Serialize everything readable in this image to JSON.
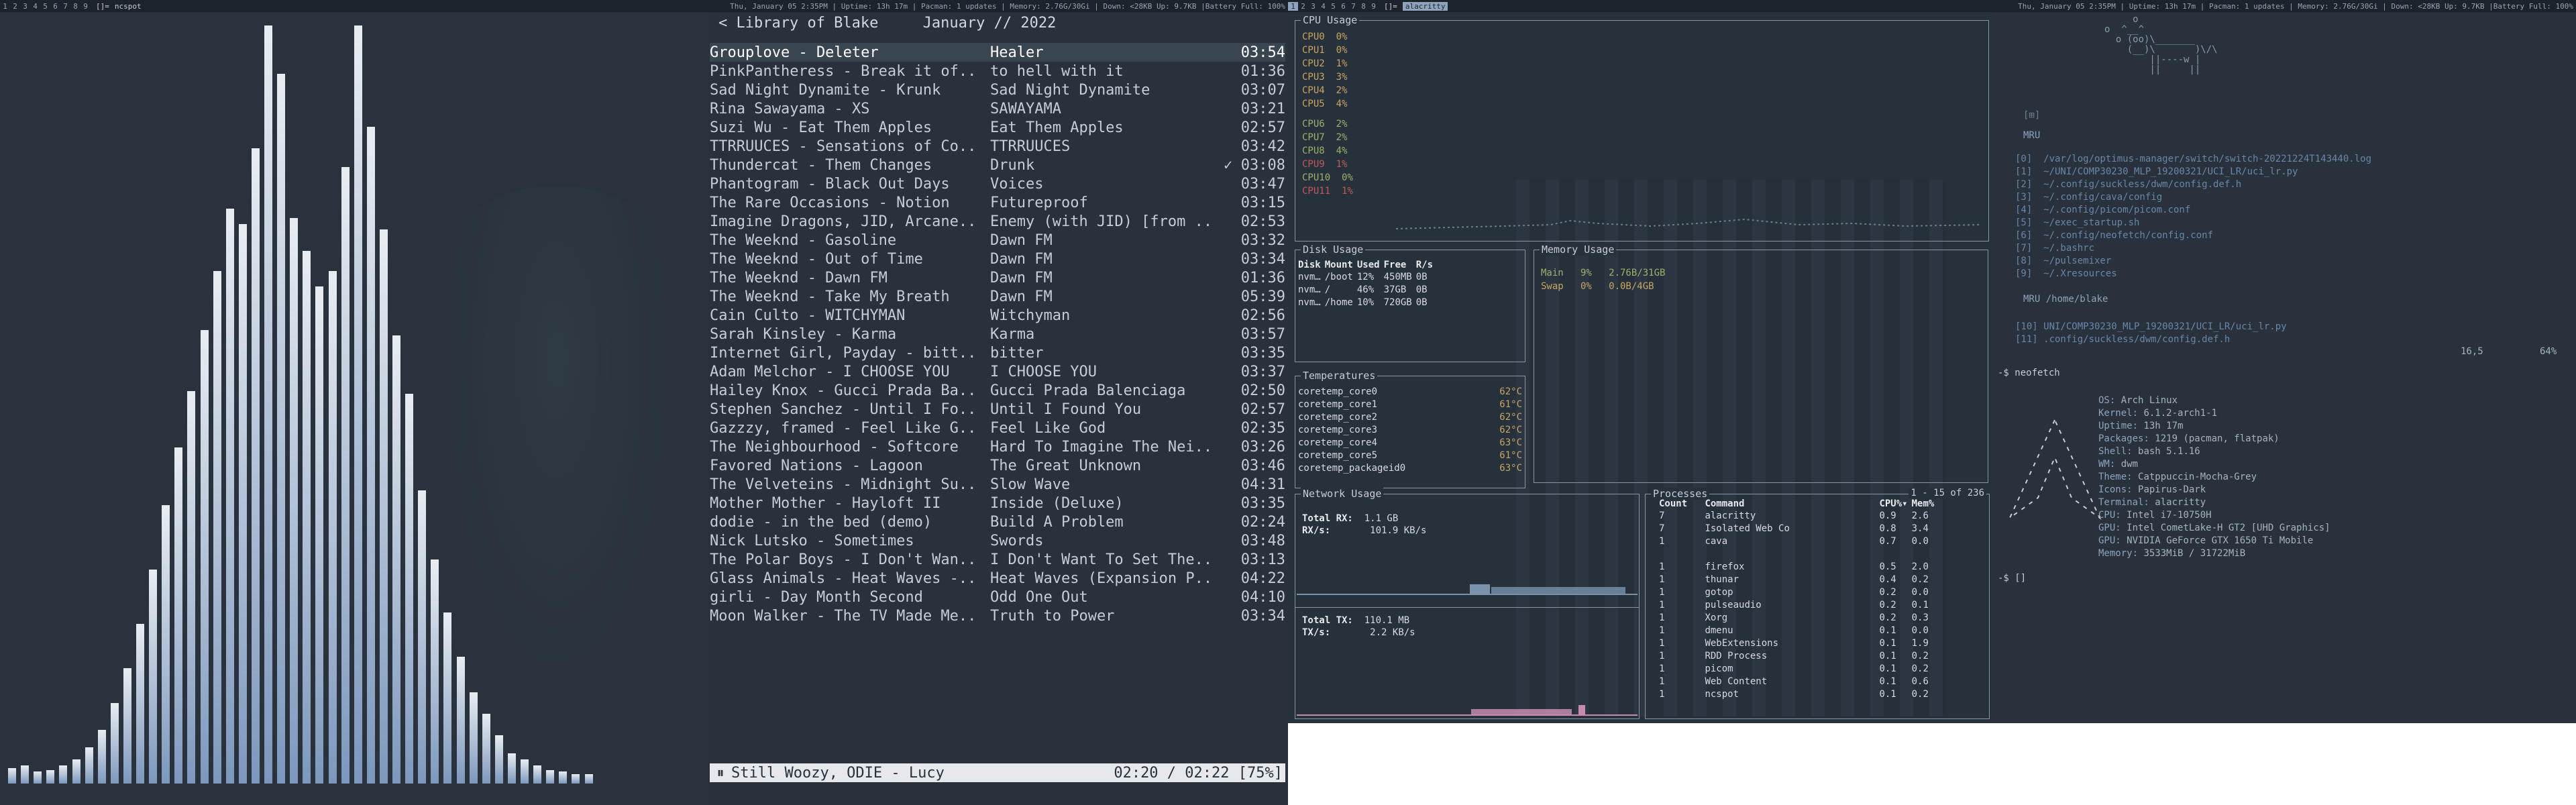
{
  "bar_left": {
    "workspaces": [
      "1",
      "2",
      "3",
      "4",
      "5",
      "6",
      "7",
      "8",
      "9"
    ],
    "layout": "[]=",
    "title": "ncspot",
    "status": "Thu, January 05 2:35PM | Uptime: 13h 17m | Pacman: 1 updates | Memory: 2.76G/30Gi | Down: <28KB Up: 9.7KB |Battery Full: 100%"
  },
  "bar_right": {
    "workspaces": [
      "1",
      "2",
      "3",
      "4",
      "5",
      "6",
      "7",
      "8",
      "9"
    ],
    "layout": "[]=",
    "title": "alacritty",
    "status": "Thu, January 05 2:35PM | Uptime: 13h 17m | Pacman: 1 updates | Memory: 2.76G/30Gi | Down: <28KB Up: 9.7KB |Battery Full: 100%"
  },
  "visualizer": {
    "bar_levels": [
      0.02,
      0.024,
      0.016,
      0.018,
      0.024,
      0.032,
      0.048,
      0.071,
      0.106,
      0.152,
      0.211,
      0.282,
      0.367,
      0.443,
      0.518,
      0.598,
      0.676,
      0.758,
      0.738,
      0.838,
      1.0,
      0.936,
      0.746,
      0.703,
      0.656,
      0.676,
      0.813,
      1.0,
      0.866,
      0.731,
      0.591,
      0.514,
      0.387,
      0.296,
      0.226,
      0.167,
      0.12,
      0.092,
      0.064,
      0.04,
      0.032,
      0.024,
      0.018,
      0.016,
      0.012,
      0.012
    ]
  },
  "music": {
    "header": "< Library of Blake     January // 2022",
    "tracks": [
      {
        "artist_title": "Grouplove - Deleter",
        "album": "Healer",
        "length": "03:54",
        "selected": true,
        "playing": false
      },
      {
        "artist_title": "PinkPantheress - Break it of..",
        "album": "to hell with it",
        "length": "01:36",
        "selected": false,
        "playing": false
      },
      {
        "artist_title": "Sad Night Dynamite - Krunk",
        "album": "Sad Night Dynamite",
        "length": "03:07",
        "selected": false,
        "playing": false
      },
      {
        "artist_title": "Rina Sawayama - XS",
        "album": "SAWAYAMA",
        "length": "03:21",
        "selected": false,
        "playing": false
      },
      {
        "artist_title": "Suzi Wu - Eat Them Apples",
        "album": "Eat Them Apples",
        "length": "02:57",
        "selected": false,
        "playing": false
      },
      {
        "artist_title": "TTRRUUCES - Sensations of Co..",
        "album": "TTRRUUCES",
        "length": "03:42",
        "selected": false,
        "playing": false
      },
      {
        "artist_title": "Thundercat - Them Changes",
        "album": "Drunk",
        "length": "03:08",
        "selected": false,
        "playing": true
      },
      {
        "artist_title": "Phantogram - Black Out Days",
        "album": "Voices",
        "length": "03:47",
        "selected": false,
        "playing": false
      },
      {
        "artist_title": "The Rare Occasions - Notion",
        "album": "Futureproof",
        "length": "03:15",
        "selected": false,
        "playing": false
      },
      {
        "artist_title": "Imagine Dragons, JID, Arcane..",
        "album": "Enemy (with JID) [from ..",
        "length": "02:53",
        "selected": false,
        "playing": false
      },
      {
        "artist_title": "The Weeknd - Gasoline",
        "album": "Dawn FM",
        "length": "03:32",
        "selected": false,
        "playing": false
      },
      {
        "artist_title": "The Weeknd - Out of Time",
        "album": "Dawn FM",
        "length": "03:34",
        "selected": false,
        "playing": false
      },
      {
        "artist_title": "The Weeknd - Dawn FM",
        "album": "Dawn FM",
        "length": "01:36",
        "selected": false,
        "playing": false
      },
      {
        "artist_title": "The Weeknd - Take My Breath",
        "album": "Dawn FM",
        "length": "05:39",
        "selected": false,
        "playing": false
      },
      {
        "artist_title": "Cain Culto - WITCHYMAN",
        "album": "Witchyman",
        "length": "02:56",
        "selected": false,
        "playing": false
      },
      {
        "artist_title": "Sarah Kinsley - Karma",
        "album": "Karma",
        "length": "03:57",
        "selected": false,
        "playing": false
      },
      {
        "artist_title": "Internet Girl, Payday - bitt..",
        "album": "bitter",
        "length": "03:35",
        "selected": false,
        "playing": false
      },
      {
        "artist_title": "Adam Melchor - I CHOOSE YOU",
        "album": "I CHOOSE YOU",
        "length": "03:37",
        "selected": false,
        "playing": false
      },
      {
        "artist_title": "Hailey Knox - Gucci Prada Ba..",
        "album": "Gucci Prada Balenciaga",
        "length": "02:50",
        "selected": false,
        "playing": false
      },
      {
        "artist_title": "Stephen Sanchez - Until I Fo..",
        "album": "Until I Found You",
        "length": "02:57",
        "selected": false,
        "playing": false
      },
      {
        "artist_title": "Gazzzy, framed - Feel Like G..",
        "album": "Feel Like God",
        "length": "02:35",
        "selected": false,
        "playing": false
      },
      {
        "artist_title": "The Neighbourhood - Softcore",
        "album": "Hard To Imagine The Nei..",
        "length": "03:26",
        "selected": false,
        "playing": false
      },
      {
        "artist_title": "Favored Nations - Lagoon",
        "album": "The Great Unknown",
        "length": "03:46",
        "selected": false,
        "playing": false
      },
      {
        "artist_title": "The Velveteins - Midnight Su..",
        "album": "Slow Wave",
        "length": "04:31",
        "selected": false,
        "playing": false
      },
      {
        "artist_title": "Mother Mother - Hayloft II",
        "album": "Inside (Deluxe)",
        "length": "03:35",
        "selected": false,
        "playing": false
      },
      {
        "artist_title": "dodie - in the bed (demo)",
        "album": "Build A Problem",
        "length": "02:24",
        "selected": false,
        "playing": false
      },
      {
        "artist_title": "Nick Lutsko - Sometimes",
        "album": "Swords",
        "length": "03:48",
        "selected": false,
        "playing": false
      },
      {
        "artist_title": "The Polar Boys - I Don't Wan..",
        "album": "I Don't Want To Set The..",
        "length": "03:13",
        "selected": false,
        "playing": false
      },
      {
        "artist_title": "Glass Animals - Heat Waves -..",
        "album": "Heat Waves (Expansion P..",
        "length": "04:22",
        "selected": false,
        "playing": false
      },
      {
        "artist_title": "girli - Day Month Second",
        "album": "Odd One Out",
        "length": "04:10",
        "selected": false,
        "playing": false
      },
      {
        "artist_title": "Moon Walker - The TV Made Me..",
        "album": "Truth to Power",
        "length": "03:34",
        "selected": false,
        "playing": false
      }
    ],
    "player": {
      "state_icon": "⏸",
      "now_playing": "Still Woozy, ODIE - Lucy",
      "time": "02:20 / 02:22 [75%]"
    }
  },
  "dashboard": {
    "cpu_title": "CPU Usage",
    "cpus": [
      {
        "name": "CPU0",
        "pct": "0%",
        "color": "#c8a560"
      },
      {
        "name": "CPU1",
        "pct": "0%",
        "color": "#c8a560"
      },
      {
        "name": "CPU2",
        "pct": "1%",
        "color": "#c8a560"
      },
      {
        "name": "CPU3",
        "pct": "3%",
        "color": "#c8a560"
      },
      {
        "name": "CPU4",
        "pct": "2%",
        "color": "#c8a560"
      },
      {
        "name": "CPU5",
        "pct": "4%",
        "color": "#c8a560"
      },
      {
        "name": "CPU6",
        "pct": "2%",
        "color": "#9ab26a"
      },
      {
        "name": "CPU7",
        "pct": "2%",
        "color": "#9ab26a"
      },
      {
        "name": "CPU8",
        "pct": "4%",
        "color": "#9ab26a"
      },
      {
        "name": "CPU9",
        "pct": "1%",
        "color": "#c05a5a"
      },
      {
        "name": "CPU10",
        "pct": "0%",
        "color": "#9ab26a"
      },
      {
        "name": "CPU11",
        "pct": "1%",
        "color": "#c05a5a"
      }
    ],
    "disk": {
      "title": "Disk Usage",
      "headers": [
        "Disk",
        "Mount",
        "Used",
        "Free",
        "R/s"
      ],
      "rows": [
        [
          "nvm…",
          "/boot",
          "12%",
          "450MB",
          "0B"
        ],
        [
          "nvm…",
          "/",
          "46%",
          "37GB",
          "0B"
        ],
        [
          "nvm…",
          "/home",
          "10%",
          "720GB",
          "0B"
        ]
      ]
    },
    "memory": {
      "title": "Memory Usage",
      "rows": [
        [
          "Main",
          "9%",
          "2.76B/31GB"
        ],
        [
          "Swap",
          "0%",
          "0.0B/4GB"
        ]
      ]
    },
    "temps": {
      "title": "Temperatures",
      "rows": [
        [
          "coretemp_core0",
          "62°C"
        ],
        [
          "coretemp_core1",
          "61°C"
        ],
        [
          "coretemp_core2",
          "62°C"
        ],
        [
          "coretemp_core3",
          "62°C"
        ],
        [
          "coretemp_core4",
          "63°C"
        ],
        [
          "coretemp_core5",
          "61°C"
        ],
        [
          "coretemp_packageid0",
          "63°C"
        ]
      ]
    },
    "network": {
      "title": "Network Usage",
      "rx_total_label": "Total RX:",
      "rx_total": "1.1 GB",
      "rx_rate_label": "RX/s:",
      "rx_rate": "101.9 KB/s",
      "tx_total_label": "Total TX:",
      "tx_total": "110.1 MB",
      "tx_rate_label": "TX/s:",
      "tx_rate": "2.2 KB/s"
    },
    "processes": {
      "title": "Processes",
      "count": "1 - 15 of 236",
      "headers": [
        "Count",
        "Command",
        "CPU%▾",
        "Mem%"
      ],
      "rows": [
        [
          "7",
          "alacritty",
          "0.9",
          "2.6"
        ],
        [
          "7",
          "Isolated Web Co",
          "0.8",
          "3.4"
        ],
        [
          "1",
          "cava",
          "0.7",
          "0.0"
        ],
        [
          "",
          "",
          "",
          ""
        ],
        [
          "1",
          "firefox",
          "0.5",
          "2.0"
        ],
        [
          "1",
          "thunar",
          "0.4",
          "0.2"
        ],
        [
          "1",
          "gotop",
          "0.2",
          "0.0"
        ],
        [
          "1",
          "pulseaudio",
          "0.2",
          "0.1"
        ],
        [
          "1",
          "Xorg",
          "0.2",
          "0.3"
        ],
        [
          "1",
          "dmenu",
          "0.1",
          "0.0"
        ],
        [
          "1",
          "WebExtensions",
          "0.1",
          "1.9"
        ],
        [
          "1",
          "RDD Process",
          "0.1",
          "0.2"
        ],
        [
          "1",
          "picom",
          "0.1",
          "0.2"
        ],
        [
          "1",
          "Web Content",
          "0.1",
          "0.6"
        ],
        [
          "1",
          "ncspot",
          "0.1",
          "0.2"
        ]
      ]
    }
  },
  "terminal": {
    "ascii_art": [
      "            o",
      "       o  ^__^",
      "         o (oo)\\_______",
      "           (__)\\       )\\/\\",
      "               ||----w |",
      "               ||     ||"
    ],
    "mru_label": "MRU",
    "mru": [
      "[0]  /var/log/optimus-manager/switch/switch-20221224T143440.log",
      "[1]  ~/UNI/COMP30230_MLP_19200321/UCI_LR/uci_lr.py",
      "[2]  ~/.config/suckless/dwm/config.def.h",
      "[3]  ~/.config/cava/config",
      "[4]  ~/.config/picom/picom.conf",
      "[5]  ~/exec_startup.sh",
      "[6]  ~/.config/neofetch/config.conf",
      "[7]  ~/.bashrc",
      "[8]  ~/pulsemixer",
      "[9]  ~/.Xresources"
    ],
    "mru_home_label": "MRU /home/blake",
    "mru_home": [
      "[10] UNI/COMP30230_MLP_19200321/UCI_LR/uci_lr.py",
      "[11] .config/suckless/dwm/config.def.h"
    ],
    "ruler": "16,5          64%",
    "prompt_cmd": "-$ neofetch",
    "neofetch": [
      [
        "OS:",
        "Arch Linux"
      ],
      [
        "Kernel:",
        "6.1.2-arch1-1"
      ],
      [
        "Uptime:",
        "13h 17m"
      ],
      [
        "Packages:",
        "1219 (pacman, flatpak)"
      ],
      [
        "Shell:",
        "bash 5.1.16"
      ],
      [
        "WM:",
        "dwm"
      ],
      [
        "Theme:",
        "Catppuccin-Mocha-Grey"
      ],
      [
        "Icons:",
        "Papirus-Dark"
      ],
      [
        "Terminal:",
        "alacritty"
      ],
      [
        "CPU:",
        "Intel i7-10750H"
      ],
      [
        "GPU:",
        "Intel CometLake-H GT2 [UHD Graphics]"
      ],
      [
        "GPU:",
        "NVIDIA GeForce GTX 1650 Ti Mobile"
      ],
      [
        "Memory:",
        "3533MiB / 31722MiB"
      ]
    ],
    "prompt_end": "-$ []"
  }
}
